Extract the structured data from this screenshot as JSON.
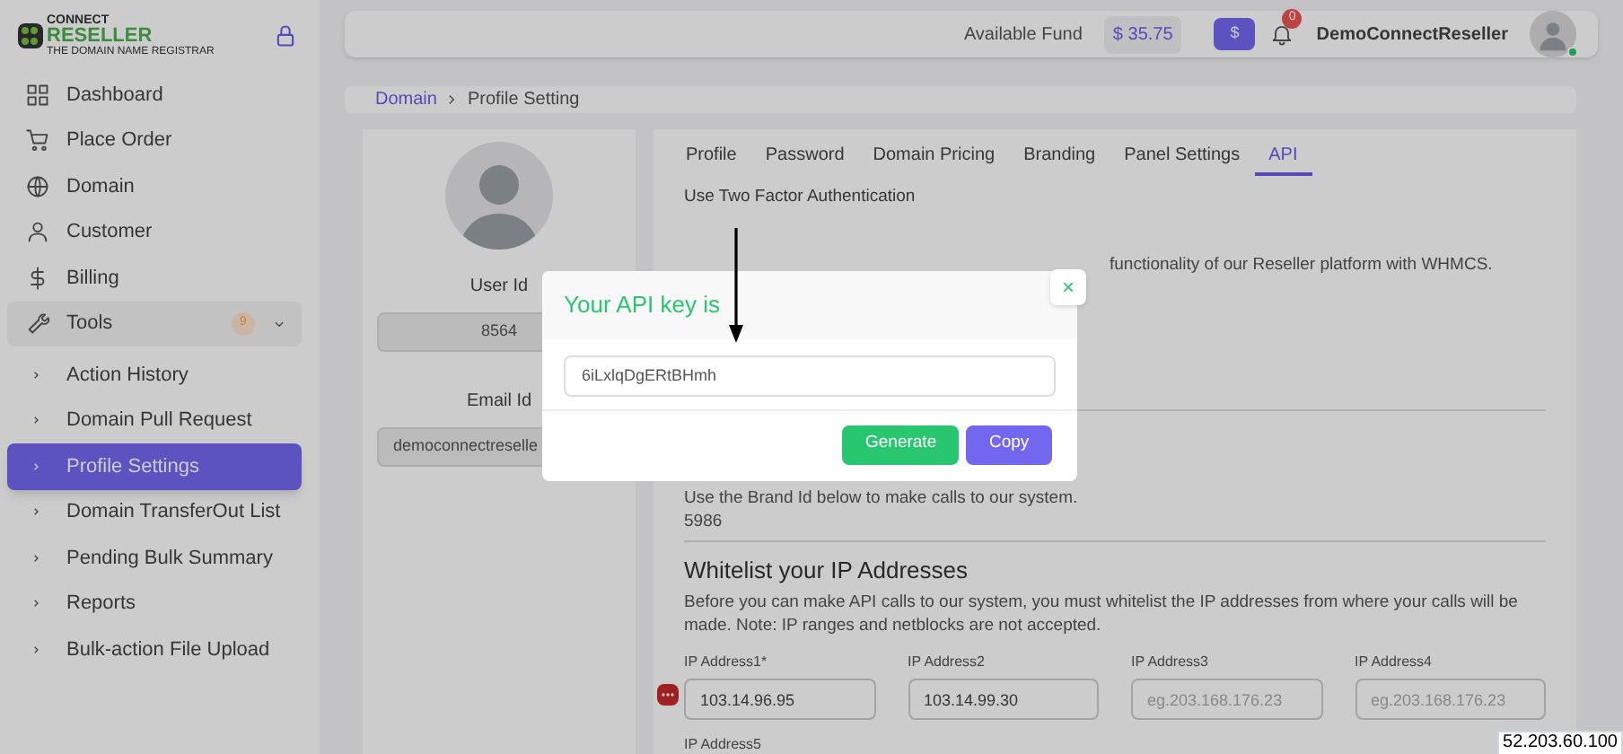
{
  "logo": {
    "line1": "CONNECT",
    "line2": "RESELLER",
    "tagline": "THE DOMAIN NAME REGISTRAR"
  },
  "sidebar": {
    "items": [
      {
        "label": "Dashboard",
        "selected": false
      },
      {
        "label": "Place Order",
        "selected": false
      },
      {
        "label": "Domain",
        "selected": false
      },
      {
        "label": "Customer",
        "selected": false
      },
      {
        "label": "Billing",
        "selected": false
      },
      {
        "label": "Tools",
        "selected": false,
        "badge": "9",
        "expanded": true,
        "children": [
          {
            "label": "Action History",
            "selected": false
          },
          {
            "label": "Domain Pull Request",
            "selected": false
          },
          {
            "label": "Profile Settings",
            "selected": true
          },
          {
            "label": "Domain TransferOut List",
            "selected": false
          },
          {
            "label": "Pending Bulk Summary",
            "selected": false
          },
          {
            "label": "Reports",
            "selected": false
          },
          {
            "label": "Bulk-action File Upload",
            "selected": false
          }
        ]
      }
    ]
  },
  "header": {
    "fund_label": "Available Fund",
    "fund_value": "$ 35.75",
    "currency_button": "$",
    "notification_count": "0",
    "username": "DemoConnectReseller",
    "online": true
  },
  "breadcrumb": [
    "Domain",
    "Profile Setting"
  ],
  "profile": {
    "user_id_label": "User Id",
    "user_id": "8564",
    "email_label": "Email Id",
    "email": "democonnectreselle"
  },
  "tabs": [
    {
      "label": "Profile",
      "selected": false
    },
    {
      "label": "Password",
      "selected": false
    },
    {
      "label": "Domain Pricing",
      "selected": false
    },
    {
      "label": "Branding",
      "selected": false
    },
    {
      "label": "Panel Settings",
      "selected": false
    },
    {
      "label": "API",
      "selected": true
    }
  ],
  "api": {
    "two_factor": "Use Two Factor Authentication",
    "intro_tail": "functionality of our Reseller platform with WHMCS.",
    "brand_text": "Use the Brand Id below to make calls to our system.",
    "brand_id": "5986",
    "whitelist_title": "Whitelist your IP Addresses",
    "whitelist_text": "Before you can make API calls to our system, you must whitelist the IP addresses from where your calls will be made. Note: IP ranges and netblocks are not accepted.",
    "ip_fields": [
      {
        "label": "IP Address1*",
        "value": "103.14.96.95"
      },
      {
        "label": "IP Address2",
        "value": "103.14.99.30"
      },
      {
        "label": "IP Address3",
        "placeholder": "eg.203.168.176.23"
      },
      {
        "label": "IP Address4",
        "placeholder": "eg.203.168.176.23"
      }
    ],
    "next_label": "IP Address5"
  },
  "modal": {
    "title": "Your API key is",
    "close": "×",
    "api_key": "6iLxlqDgERtBHmh",
    "buttons": [
      {
        "label": "Generate",
        "kind": "success"
      },
      {
        "label": "Copy",
        "kind": "primary"
      }
    ]
  },
  "tooltip": "52.203.60.100"
}
